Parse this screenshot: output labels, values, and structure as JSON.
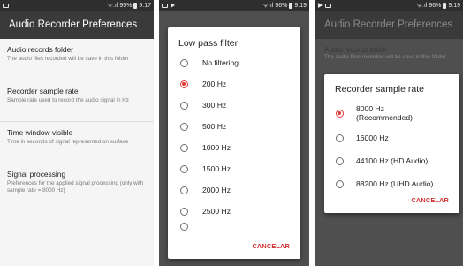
{
  "screen1": {
    "status": {
      "signal": "ᯤ.ıl",
      "battery": "95%",
      "time": "9:17"
    },
    "title": "Audio Recorder Preferences",
    "prefs": [
      {
        "title": "Audio records folder",
        "summary": "The audio files recorded will be save in this folder"
      },
      {
        "title": "Recorder sample rate",
        "summary": "Sample rate used to record the audio signal in Hz"
      },
      {
        "title": "Time window visible",
        "summary": "Time in seconds of signal represented on surface"
      },
      {
        "title": "Signal processing",
        "summary": "Preferences for the applied signal processing (only with sample rate = 8000 Hz)"
      }
    ]
  },
  "screen2": {
    "status": {
      "signal": "ᯤ.ıl",
      "battery": "96%",
      "time": "9:19"
    },
    "dialog": {
      "title": "Low pass filter",
      "options": [
        "No filtering",
        "200 Hz",
        "300 Hz",
        "500 Hz",
        "1000 Hz",
        "1500 Hz",
        "2000 Hz",
        "2500 Hz"
      ],
      "selected_index": 1,
      "cancel": "CANCELAR"
    }
  },
  "screen3": {
    "status": {
      "signal": "ᯤ.ıl",
      "battery": "96%",
      "time": "9:19"
    },
    "title": "Audio Recorder Preferences",
    "bg_pref": {
      "title": "Audio records folder",
      "summary": "The audio files recorded will be save in this folder"
    },
    "dialog": {
      "title": "Recorder sample rate",
      "options": [
        "8000 Hz (Recommended)",
        "16000 Hz",
        "44100 Hz (HD Audio)",
        "88200 Hz (UHD Audio)"
      ],
      "selected_index": 0,
      "cancel": "CANCELAR"
    }
  },
  "colors": {
    "accent": "#e53935",
    "appbar": "#3a3a3a",
    "statusbar": "#2e2e2e"
  }
}
